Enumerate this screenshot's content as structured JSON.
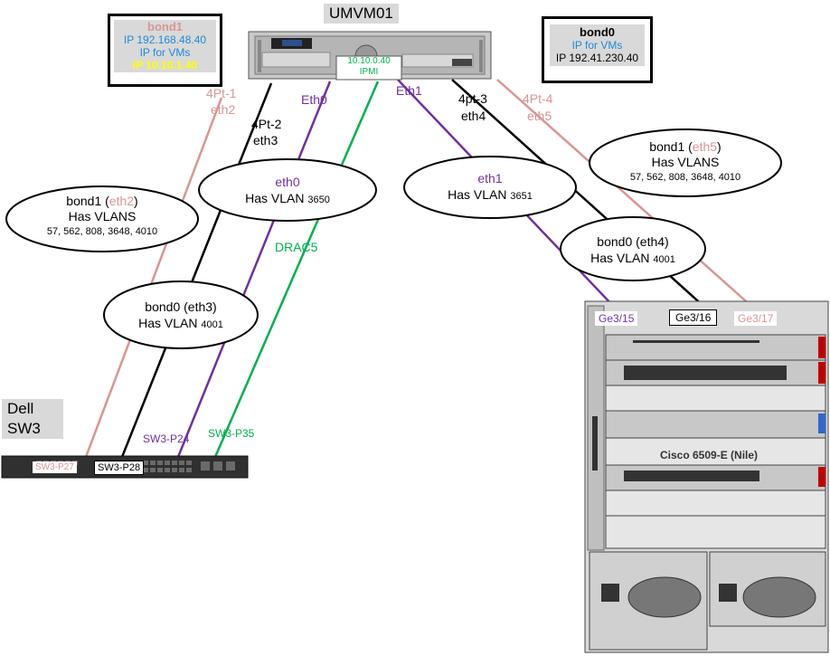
{
  "colors": {
    "purple": "#7030a0",
    "green": "#00b050",
    "pink": "#d99594",
    "blue": "#1f8ad6",
    "yellow": "#ffff00"
  },
  "server": {
    "title": "UMVM01",
    "drac_ip": "10.10.0.40",
    "drac_label": "IPMI"
  },
  "bond1_box": {
    "title": "bond1",
    "ip": "IP 192.168.48.40",
    "vm_label": "IP for VMs",
    "ip2": "IP 10.10.1.40"
  },
  "bond0_box": {
    "title": "bond0",
    "vm_label": "IP for VMs",
    "ip": "IP 192.41.230.40"
  },
  "port_labels": {
    "pt1_a": "4Pt-1",
    "pt1_b": "eth2",
    "pt2_a": "4Pt-2",
    "pt2_b": "eth3",
    "eth0": "Eth0",
    "eth1": "Eth1",
    "pt3_a": "4pt-3",
    "pt3_b": "eth4",
    "pt4_a": "4Pt-4",
    "pt4_b": "eth5",
    "drac": "DRAC5"
  },
  "ellipses": {
    "eth0": {
      "name": "eth0",
      "vlan_text": "Has VLAN ",
      "vlan": "3650"
    },
    "eth1": {
      "name": "eth1",
      "vlan_text": "Has VLAN ",
      "vlan": "3651"
    },
    "bond1_left": {
      "name": "bond1 (",
      "iface": "eth2",
      "close": ")",
      "line2": "Has VLANS",
      "vlans": "57, 562, 808, 3648, 4010"
    },
    "bond1_right": {
      "name": "bond1 (",
      "iface": "eth5",
      "close": ")",
      "line2": "Has VLANS",
      "vlans": "57, 562, 808, 3648, 4010"
    },
    "bond0_left": {
      "name": "bond0 (eth3)",
      "vlan_text": "Has VLAN ",
      "vlan": "4001"
    },
    "bond0_right": {
      "name": "bond0 (eth4)",
      "vlan_text": "Has VLAN ",
      "vlan": "4001"
    }
  },
  "dell": {
    "name": "Dell",
    "model": "SW3",
    "p27": "SW3-P27",
    "p28": "SW3-P28",
    "p24": "SW3-P24",
    "p35": "SW3-P35"
  },
  "cisco": {
    "gp15": "Ge3/15",
    "gp16": "Ge3/16",
    "gp17": "Ge3/17",
    "model": "Cisco 6509-E (Nile)"
  }
}
